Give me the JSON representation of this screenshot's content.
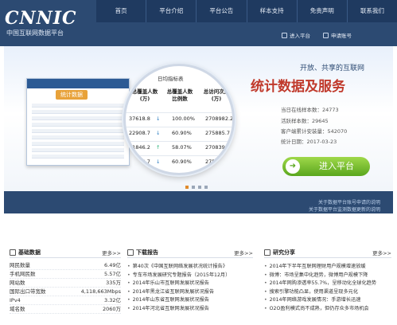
{
  "header": {
    "logo_text": "CNNIC",
    "logo_subtitle": "中国互联网数据平台",
    "nav": [
      "首页",
      "平台介绍",
      "平台公告",
      "样本支持",
      "免责声明",
      "联系我们"
    ],
    "links": {
      "login": "进入平台",
      "apply": "申请账号"
    }
  },
  "banner": {
    "screen_badge": "统计数据",
    "lens": {
      "title": "日均指标表",
      "headers": [
        "总覆盖人数(万)",
        "总覆盖人数比例数",
        "总访问次数(万)"
      ],
      "rows": [
        {
          "c1": "37618.8",
          "dir": "down",
          "c2": "100.00%",
          "c3": "2708982.2"
        },
        {
          "c1": "22908.7",
          "dir": "down",
          "c2": "60.90%",
          "c3": "275885.7"
        },
        {
          "c1": "21846.2",
          "dir": "up",
          "c2": "58.07%",
          "c3": "270839.2"
        },
        {
          "c1": "22908.7",
          "dir": "down",
          "c2": "60.90%",
          "c3": "275885.7"
        }
      ]
    },
    "slogan_small": "开放、共享的互联网",
    "slogan_big": "统计数据及服务",
    "stats": [
      "当日在线样本数：24773",
      "活跃样本数：29645",
      "客户端累计安装量：542070",
      "统计日期：2017-03-23"
    ],
    "enter_button": "进入平台",
    "footer_links": [
      "关于数据平台账号申请的说明",
      "关于数据平台监测数据更新的说明"
    ]
  },
  "panels": {
    "basic": {
      "title": "基础数据",
      "more": "更多>>",
      "rows": [
        {
          "label": "网民数量",
          "value": "6.49亿"
        },
        {
          "label": "手机网民数",
          "value": "5.57亿"
        },
        {
          "label": "网站数",
          "value": "335万"
        },
        {
          "label": "国际出口带宽数",
          "value": "4,118,663Mbps"
        },
        {
          "label": "IPv4",
          "value": "3.32亿"
        },
        {
          "label": "域名数",
          "value": "2060万"
        }
      ]
    },
    "reports": {
      "title": "下载报告",
      "more": "更多>>",
      "items": [
        "第40次《中国互联网络发展状况统计报告》",
        "专车市场发展研究专题报告（2015年12月）",
        "2014年乐山市互联网发展状况报告",
        "2014年黑龙江省互联网发展状况报告",
        "2014年山东省互联网发展状况报告",
        "2014年河北省互联网发展状况报告"
      ]
    },
    "research": {
      "title": "研究分享",
      "more": "更多>>",
      "items": [
        "2014年下半年互联网理财用户规模增速放缓",
        "微博：市场呈集中化趋势，微博用户规模下降",
        "2014年网购渗透率55.7%，呈移动化全球化趋势",
        "搜索引擎功能凸显，使用渠道呈现多元化",
        "2014年网络游戏发展情况：手游增长迅速",
        "O2O盈利模式尚不成熟，但仍存众多市场机会"
      ]
    }
  }
}
